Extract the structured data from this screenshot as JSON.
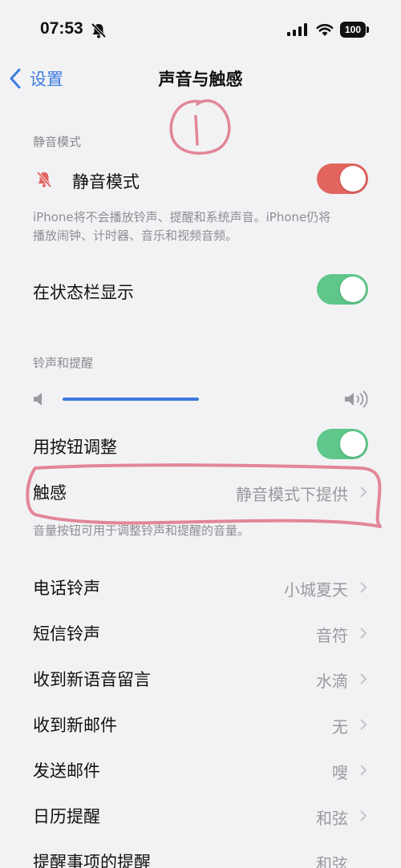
{
  "status_bar": {
    "time": "07:53",
    "battery": "100"
  },
  "nav": {
    "back_label": "设置",
    "title": "声音与触感"
  },
  "silent_section": {
    "header": "静音模式",
    "silent_label": "静音模式",
    "silent_on": true,
    "silent_color": "#e2645e",
    "footnote_line1": "iPhone将不会播放铃声、提醒和系统声音。iPhone仍将",
    "footnote_line2": "播放闹钟、计时器、音乐和视频音频。",
    "statusbar_label": "在状态栏显示",
    "statusbar_on": true
  },
  "ringer_section": {
    "header": "铃声和提醒",
    "volume_level": 0.45,
    "change_with_buttons_label": "用按钮调整",
    "change_with_buttons_on": true,
    "haptics_label": "触感",
    "haptics_value": "静音模式下提供",
    "footnote": "音量按钮可用于调整铃声和提醒的音量。"
  },
  "sounds_list": [
    {
      "label": "电话铃声",
      "value": "小城夏天"
    },
    {
      "label": "短信铃声",
      "value": "音符"
    },
    {
      "label": "收到新语音留言",
      "value": "水滴"
    },
    {
      "label": "收到新邮件",
      "value": "无"
    },
    {
      "label": "发送邮件",
      "value": "嗖"
    },
    {
      "label": "日历提醒",
      "value": "和弦"
    },
    {
      "label": "提醒事项的提醒",
      "value": "和弦"
    }
  ],
  "annotation": {
    "mark": "①",
    "color": "#e07a8e"
  },
  "colors": {
    "accent": "#3c7be0",
    "toggle_green": "#5fc78a",
    "background": "#f2f2f4"
  }
}
